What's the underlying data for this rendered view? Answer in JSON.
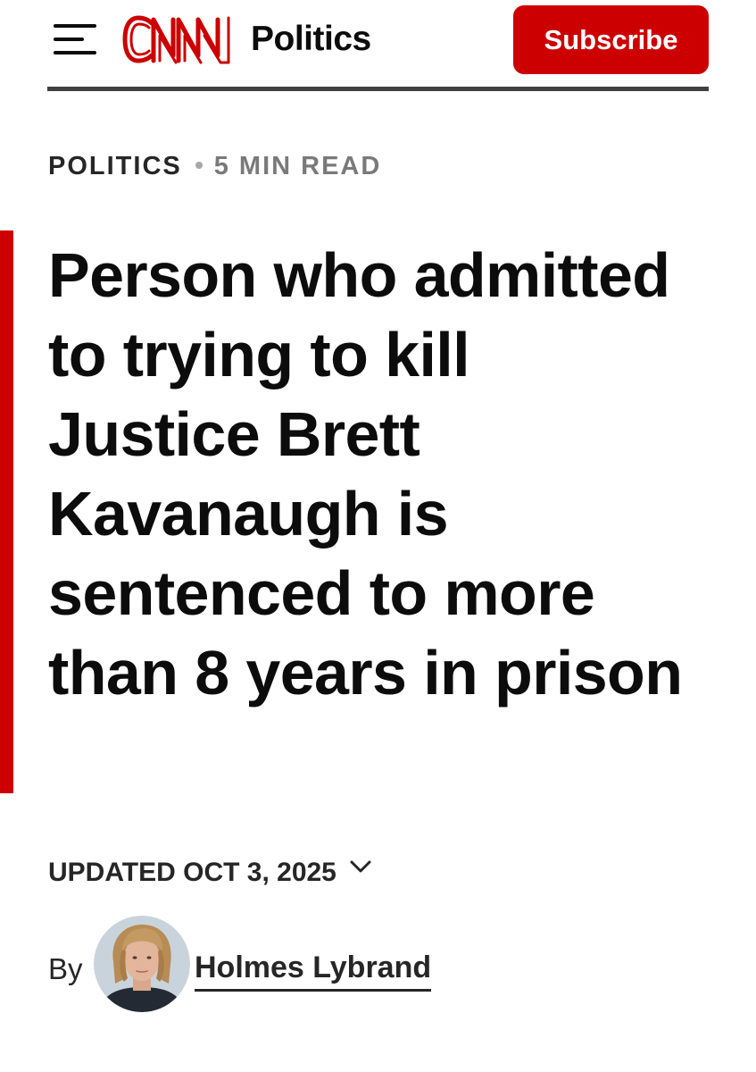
{
  "header": {
    "logo_text": "CNN",
    "section_title": "Politics",
    "subscribe_label": "Subscribe",
    "menu_icon": "hamburger-menu-icon"
  },
  "article": {
    "section": "POLITICS",
    "read_time": "5 MIN READ",
    "headline": "Person who admitted to trying to kill Justice Brett Kavanaugh is sentenced to more than 8 years in prison",
    "updated": "UPDATED OCT 3, 2025",
    "expand_icon": "chevron-down-icon",
    "byline": {
      "prefix": "By",
      "author": "Holmes Lybrand"
    }
  },
  "colors": {
    "brand_red": "#cc0000",
    "text": "#0c0c0c",
    "muted": "#7a7a7a",
    "divider": "#404040"
  }
}
